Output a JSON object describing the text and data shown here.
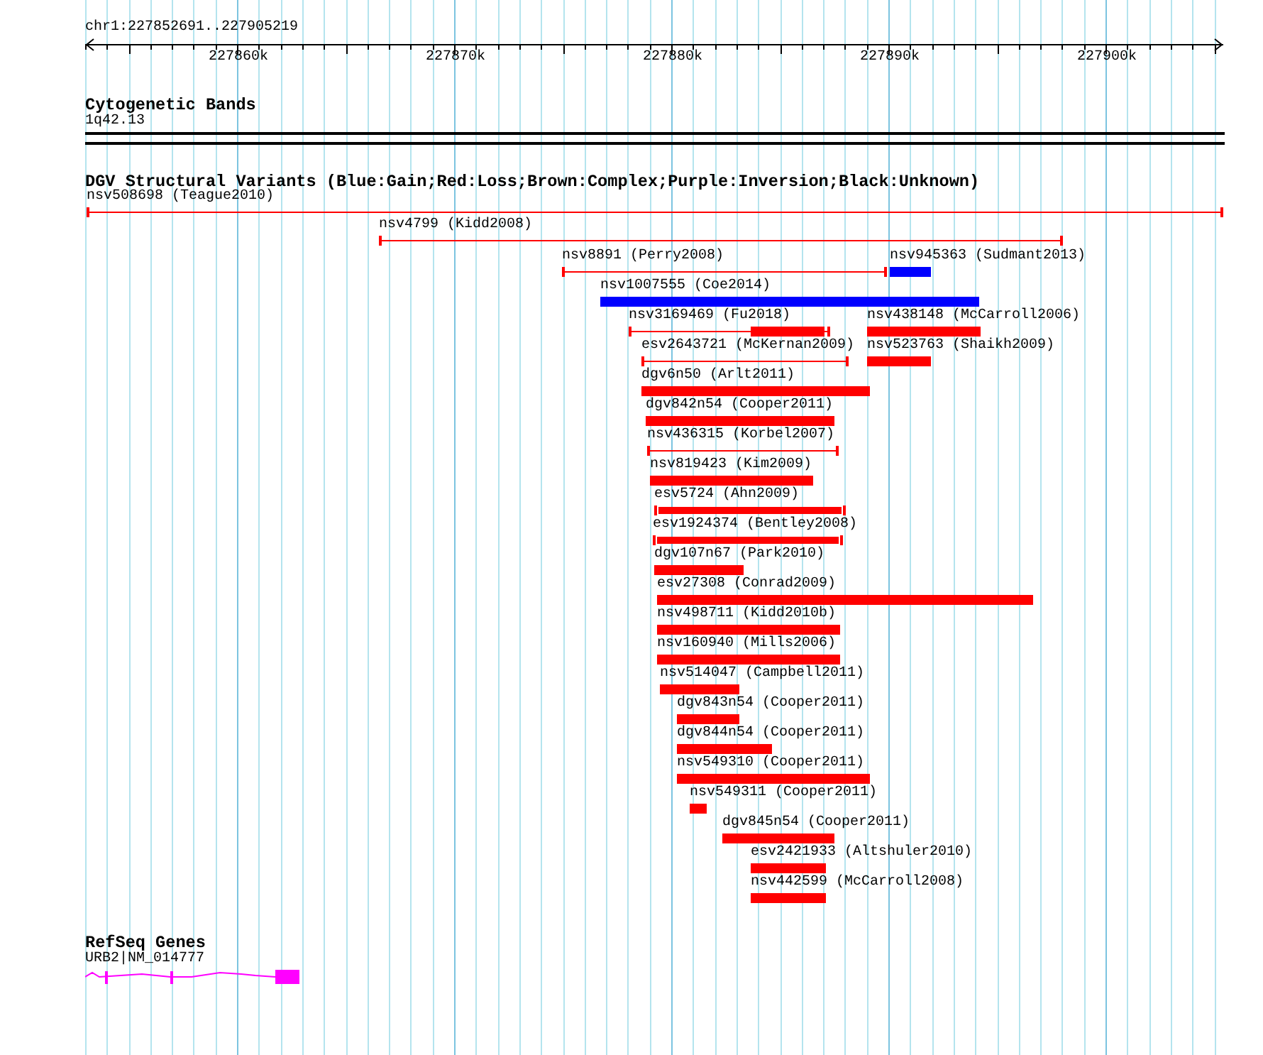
{
  "position": "chr1:227852691..227905219",
  "ruler": {
    "ticks": [
      "227860k",
      "227870k",
      "227880k",
      "227890k",
      "227900k"
    ]
  },
  "cytogenetic_bands": {
    "title": "Cytogenetic Bands",
    "band": "1q42.13"
  },
  "dgv": {
    "title": "DGV Structural Variants (Blue:Gain;Red:Loss;Brown:Complex;Purple:Inversion;Black:Unknown)",
    "features": [
      {
        "label": "nsv508698 (Teague2010)",
        "kind": "line",
        "color": "#ff0000"
      },
      {
        "label": "nsv4799 (Kidd2008)",
        "kind": "line",
        "color": "#ff0000"
      },
      {
        "label": "nsv8891 (Perry2008)",
        "kind": "line",
        "color": "#ff0000"
      },
      {
        "label": "nsv945363 (Sudmant2013)",
        "kind": "bar",
        "color": "#0000ff"
      },
      {
        "label": "nsv1007555 (Coe2014)",
        "kind": "bar",
        "color": "#0000ff"
      },
      {
        "label": "nsv3169469 (Fu2018)",
        "kind": "line-with-bar",
        "color": "#ff0000"
      },
      {
        "label": "nsv438148 (McCarroll2006)",
        "kind": "bar",
        "color": "#ff0000"
      },
      {
        "label": "esv2643721 (McKernan2009)",
        "kind": "line",
        "color": "#ff0000"
      },
      {
        "label": "nsv523763 (Shaikh2009)",
        "kind": "bar",
        "color": "#ff0000"
      },
      {
        "label": "dgv6n50 (Arlt2011)",
        "kind": "bar",
        "color": "#ff0000"
      },
      {
        "label": "dgv842n54 (Cooper2011)",
        "kind": "bar",
        "color": "#ff0000"
      },
      {
        "label": "nsv436315 (Korbel2007)",
        "kind": "line",
        "color": "#ff0000"
      },
      {
        "label": "nsv819423 (Kim2009)",
        "kind": "bar",
        "color": "#ff0000"
      },
      {
        "label": "esv5724 (Ahn2009)",
        "kind": "capped-bar",
        "color": "#ff0000"
      },
      {
        "label": "esv1924374 (Bentley2008)",
        "kind": "capped-bar",
        "color": "#ff0000"
      },
      {
        "label": "dgv107n67 (Park2010)",
        "kind": "bar",
        "color": "#ff0000"
      },
      {
        "label": "esv27308 (Conrad2009)",
        "kind": "bar",
        "color": "#ff0000"
      },
      {
        "label": "nsv498711 (Kidd2010b)",
        "kind": "bar",
        "color": "#ff0000"
      },
      {
        "label": "nsv160940 (Mills2006)",
        "kind": "bar",
        "color": "#ff0000"
      },
      {
        "label": "nsv514047 (Campbell2011)",
        "kind": "bar",
        "color": "#ff0000"
      },
      {
        "label": "dgv843n54 (Cooper2011)",
        "kind": "bar",
        "color": "#ff0000"
      },
      {
        "label": "dgv844n54 (Cooper2011)",
        "kind": "bar",
        "color": "#ff0000"
      },
      {
        "label": "nsv549310 (Cooper2011)",
        "kind": "bar",
        "color": "#ff0000"
      },
      {
        "label": "nsv549311 (Cooper2011)",
        "kind": "bar",
        "color": "#ff0000"
      },
      {
        "label": "dgv845n54 (Cooper2011)",
        "kind": "bar",
        "color": "#ff0000"
      },
      {
        "label": "esv2421933 (Altshuler2010)",
        "kind": "bar",
        "color": "#ff0000"
      },
      {
        "label": "nsv442599 (McCarroll2008)",
        "kind": "bar",
        "color": "#ff0000"
      }
    ]
  },
  "refseq": {
    "title": "RefSeq Genes",
    "gene": "URB2|NM_014777"
  }
}
